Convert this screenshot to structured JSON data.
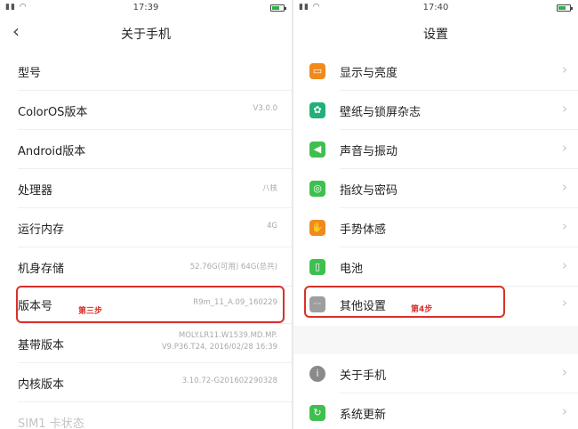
{
  "left": {
    "status": {
      "signal": "▮▮ ◠",
      "time": "17:39"
    },
    "title": "关于手机",
    "rows": [
      {
        "label": "型号",
        "value": ""
      },
      {
        "label": "ColorOS版本",
        "value": "V3.0.0"
      },
      {
        "label": "Android版本",
        "value": ""
      },
      {
        "label": "处理器",
        "value": "八核"
      },
      {
        "label": "运行内存",
        "value": "4G"
      },
      {
        "label": "机身存储",
        "value": "52.76G(可用)  64G(总共)"
      },
      {
        "label": "版本号",
        "value": "R9m_11_A.09_160229"
      },
      {
        "label": "基带版本",
        "value_line1": "MOLY.LR11.W1539.MD.MP.",
        "value_line2": "V9.P36.T24, 2016/02/28 16:39"
      },
      {
        "label": "内核版本",
        "value": "3.10.72-G201602290328"
      },
      {
        "label": "SIM1 卡状态",
        "value": ""
      }
    ],
    "step_label": "第三步"
  },
  "right": {
    "status": {
      "signal": "▮▮ ◠",
      "time": "17:40"
    },
    "title": "设置",
    "items": [
      {
        "label": "显示与亮度",
        "icon": "display-icon",
        "color": "#f08a1c",
        "glyph": "▭"
      },
      {
        "label": "壁纸与锁屏杂志",
        "icon": "wallpaper-icon",
        "color": "#22b07a",
        "glyph": "✿"
      },
      {
        "label": "声音与振动",
        "icon": "sound-icon",
        "color": "#3fbf4f",
        "glyph": "◀"
      },
      {
        "label": "指纹与密码",
        "icon": "fingerprint-icon",
        "color": "#3fbf4f",
        "glyph": "◎"
      },
      {
        "label": "手势体感",
        "icon": "gesture-icon",
        "color": "#f08a1c",
        "glyph": "✋"
      },
      {
        "label": "电池",
        "icon": "battery-icon",
        "color": "#3fbf4f",
        "glyph": "▯"
      },
      {
        "label": "其他设置",
        "icon": "more-icon",
        "color": "#9e9e9e",
        "glyph": "···"
      },
      {
        "label": "关于手机",
        "icon": "info-icon",
        "color": "#8a8a8a",
        "glyph": "i"
      },
      {
        "label": "系统更新",
        "icon": "update-icon",
        "color": "#3fbf4f",
        "glyph": "↻"
      }
    ],
    "step_label": "第4步"
  },
  "colors": {
    "highlight": "#d9302a",
    "battery": "#2fb04a"
  }
}
